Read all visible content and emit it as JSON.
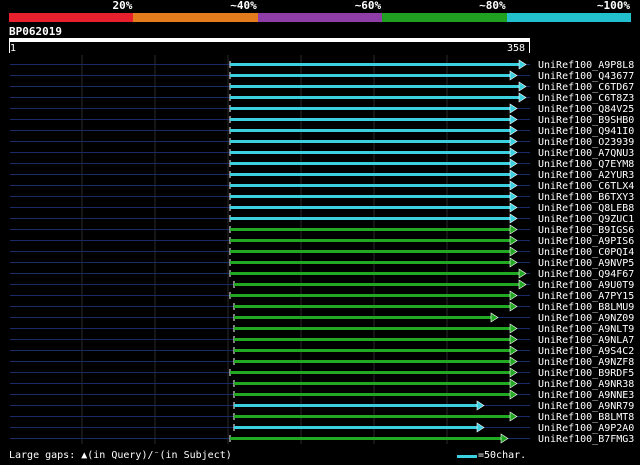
{
  "legend": {
    "colors": [
      "#e8202e",
      "#e27c1c",
      "#8e3ea6",
      "#20a020",
      "#22c0cc"
    ],
    "labels": [
      "20%",
      "~40%",
      "~60%",
      "~80%",
      "~100%"
    ]
  },
  "query": {
    "id": "BP062019",
    "start": "1",
    "end": "358"
  },
  "hits": [
    {
      "id": "UniRef100_A9P8L8",
      "color": "#3ad0e0",
      "qs": 230,
      "qe": 526,
      "arrow": true
    },
    {
      "id": "UniRef100_Q43677",
      "color": "#3ad0e0",
      "qs": 230,
      "qe": 517,
      "arrow": true
    },
    {
      "id": "UniRef100_C6TD67",
      "color": "#3ad0e0",
      "qs": 230,
      "qe": 526,
      "arrow": true
    },
    {
      "id": "UniRef100_C6T8Z3",
      "color": "#3ad0e0",
      "qs": 230,
      "qe": 526,
      "arrow": true
    },
    {
      "id": "UniRef100_Q84V25",
      "color": "#3ad0e0",
      "qs": 230,
      "qe": 517,
      "arrow": true
    },
    {
      "id": "UniRef100_B9SHB0",
      "color": "#3ad0e0",
      "qs": 230,
      "qe": 517,
      "arrow": true
    },
    {
      "id": "UniRef100_Q941I0",
      "color": "#3ad0e0",
      "qs": 230,
      "qe": 517,
      "arrow": true
    },
    {
      "id": "UniRef100_O23939",
      "color": "#3ad0e0",
      "qs": 230,
      "qe": 517,
      "arrow": true
    },
    {
      "id": "UniRef100_A7QNU3",
      "color": "#3ad0e0",
      "qs": 230,
      "qe": 517,
      "arrow": true
    },
    {
      "id": "UniRef100_Q7EYM8",
      "color": "#3ad0e0",
      "qs": 230,
      "qe": 517,
      "arrow": true
    },
    {
      "id": "UniRef100_A2YUR3",
      "color": "#3ad0e0",
      "qs": 230,
      "qe": 517,
      "arrow": true
    },
    {
      "id": "UniRef100_C6TLX4",
      "color": "#3ad0e0",
      "qs": 230,
      "qe": 517,
      "arrow": true
    },
    {
      "id": "UniRef100_B6TXY3",
      "color": "#3ad0e0",
      "qs": 230,
      "qe": 517,
      "arrow": true
    },
    {
      "id": "UniRef100_Q8LEB8",
      "color": "#3ad0e0",
      "qs": 230,
      "qe": 517,
      "arrow": true
    },
    {
      "id": "UniRef100_Q9ZUC1",
      "color": "#3ad0e0",
      "qs": 230,
      "qe": 517,
      "arrow": true
    },
    {
      "id": "UniRef100_B9IGS6",
      "color": "#22a922",
      "qs": 230,
      "qe": 517,
      "arrow": true
    },
    {
      "id": "UniRef100_A9PIS6",
      "color": "#22a922",
      "qs": 230,
      "qe": 517,
      "arrow": true
    },
    {
      "id": "UniRef100_C0PQI4",
      "color": "#22a922",
      "qs": 230,
      "qe": 517,
      "arrow": true
    },
    {
      "id": "UniRef100_A9NVP5",
      "color": "#22a922",
      "qs": 230,
      "qe": 517,
      "arrow": true
    },
    {
      "id": "UniRef100_Q94F67",
      "color": "#22a922",
      "qs": 230,
      "qe": 526,
      "arrow": true
    },
    {
      "id": "UniRef100_A9U0T9",
      "color": "#22a922",
      "qs": 234,
      "qe": 526,
      "arrow": true
    },
    {
      "id": "UniRef100_A7PY15",
      "color": "#22a922",
      "qs": 230,
      "qe": 517,
      "arrow": true
    },
    {
      "id": "UniRef100_B8LMU9",
      "color": "#22a922",
      "qs": 234,
      "qe": 517,
      "arrow": true
    },
    {
      "id": "UniRef100_A9NZ09",
      "color": "#22a922",
      "qs": 234,
      "qe": 498,
      "arrow": true
    },
    {
      "id": "UniRef100_A9NLT9",
      "color": "#22a922",
      "qs": 234,
      "qe": 517,
      "arrow": true
    },
    {
      "id": "UniRef100_A9NLA7",
      "color": "#22a922",
      "qs": 234,
      "qe": 517,
      "arrow": true
    },
    {
      "id": "UniRef100_A9S4C2",
      "color": "#22a922",
      "qs": 234,
      "qe": 517,
      "arrow": true
    },
    {
      "id": "UniRef100_A9NZF8",
      "color": "#22a922",
      "qs": 234,
      "qe": 517,
      "arrow": true
    },
    {
      "id": "UniRef100_B9RDF5",
      "color": "#22a922",
      "qs": 230,
      "qe": 517,
      "arrow": true
    },
    {
      "id": "UniRef100_A9NR38",
      "color": "#22a922",
      "qs": 234,
      "qe": 517,
      "arrow": true
    },
    {
      "id": "UniRef100_A9NNE3",
      "color": "#22a922",
      "qs": 234,
      "qe": 517,
      "arrow": true
    },
    {
      "id": "UniRef100_A9NR79",
      "color": "#3ad0e0",
      "qs": 234,
      "qe": 484,
      "arrow": true
    },
    {
      "id": "UniRef100_B8LMT8",
      "color": "#22a922",
      "qs": 234,
      "qe": 517,
      "arrow": true
    },
    {
      "id": "UniRef100_A9P2A0",
      "color": "#3ad0e0",
      "qs": 234,
      "qe": 484,
      "arrow": true
    },
    {
      "id": "UniRef100_B7FMG3",
      "color": "#22a922",
      "qs": 230,
      "qe": 508,
      "arrow": true
    }
  ],
  "footer": {
    "gaps_text": "Large gaps: ▲(in Query)/⁻(in Subject)",
    "scale_text": "=50char."
  }
}
